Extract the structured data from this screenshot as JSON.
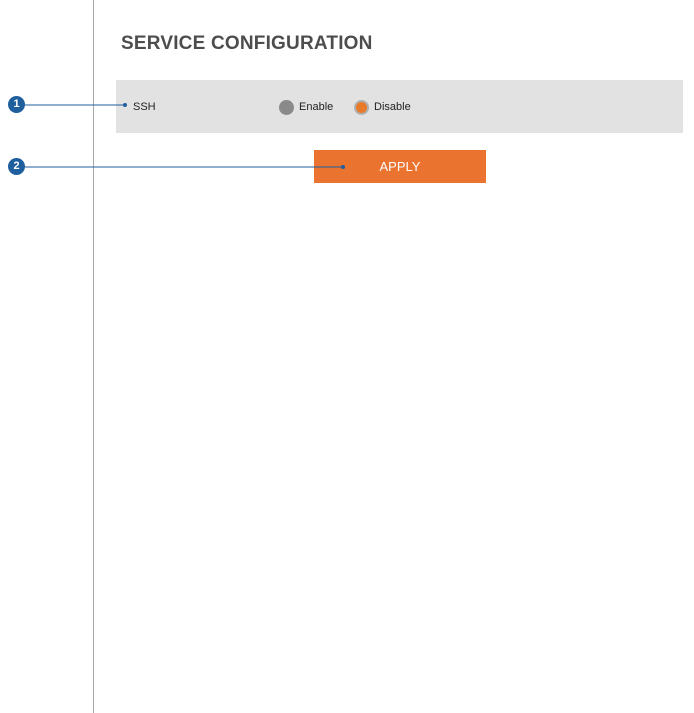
{
  "page": {
    "title": "SERVICE CONFIGURATION"
  },
  "settings": {
    "ssh": {
      "label": "SSH",
      "options": [
        {
          "label": "Enable",
          "selected": false
        },
        {
          "label": "Disable",
          "selected": true
        }
      ]
    }
  },
  "actions": {
    "apply_label": "APPLY"
  },
  "callouts": [
    {
      "number": "1"
    },
    {
      "number": "2"
    }
  ],
  "colors": {
    "accent": "#ea7330",
    "callout": "#1f5f9e",
    "row_background": "#e2e2e2",
    "radio_unselected": "#8a8a8a"
  }
}
